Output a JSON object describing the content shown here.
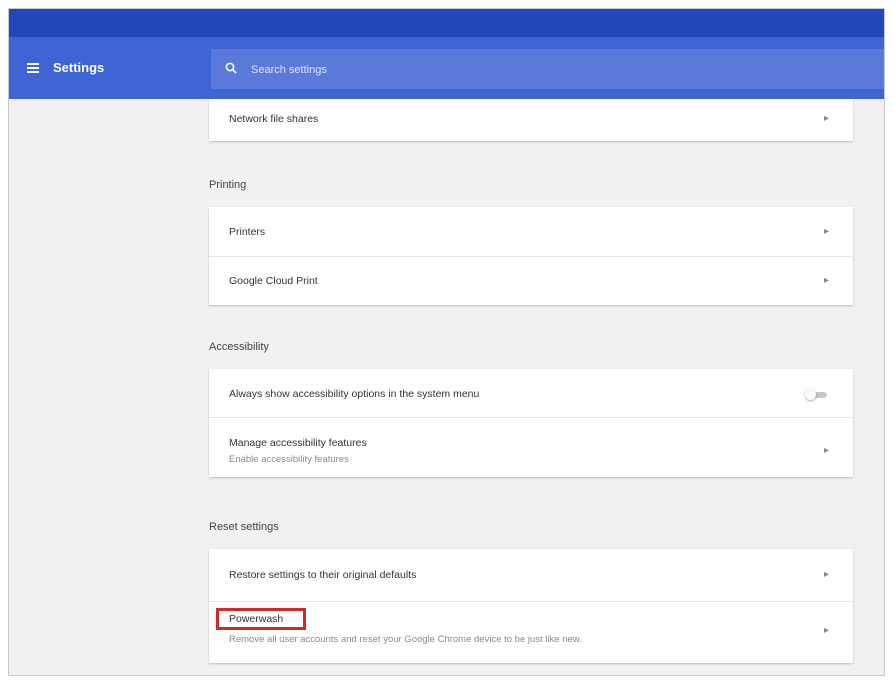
{
  "header": {
    "app_title": "Settings",
    "search_placeholder": "Search settings"
  },
  "network_card": {
    "items": [
      {
        "label": "Network file shares"
      }
    ]
  },
  "printing": {
    "title": "Printing",
    "items": [
      {
        "label": "Printers"
      },
      {
        "label": "Google Cloud Print"
      }
    ]
  },
  "accessibility": {
    "title": "Accessibility",
    "toggle_item": {
      "label": "Always show accessibility options in the system menu",
      "enabled": false
    },
    "manage_item": {
      "label": "Manage accessibility features",
      "sublabel": "Enable accessibility features"
    }
  },
  "reset": {
    "title": "Reset settings",
    "items": [
      {
        "label": "Restore settings to their original defaults"
      },
      {
        "label": "Powerwash",
        "sublabel": "Remove all user accounts and reset your Google Chrome device to be just like new.",
        "highlighted": true
      }
    ]
  },
  "icons": {
    "menu": "hamburger-menu-icon",
    "search": "search-icon",
    "chevron": "chevron-right-icon"
  },
  "colors": {
    "header_blue": "#3f64d4",
    "top_band_blue": "#2148b8",
    "highlight_red": "#cc2b2b"
  }
}
